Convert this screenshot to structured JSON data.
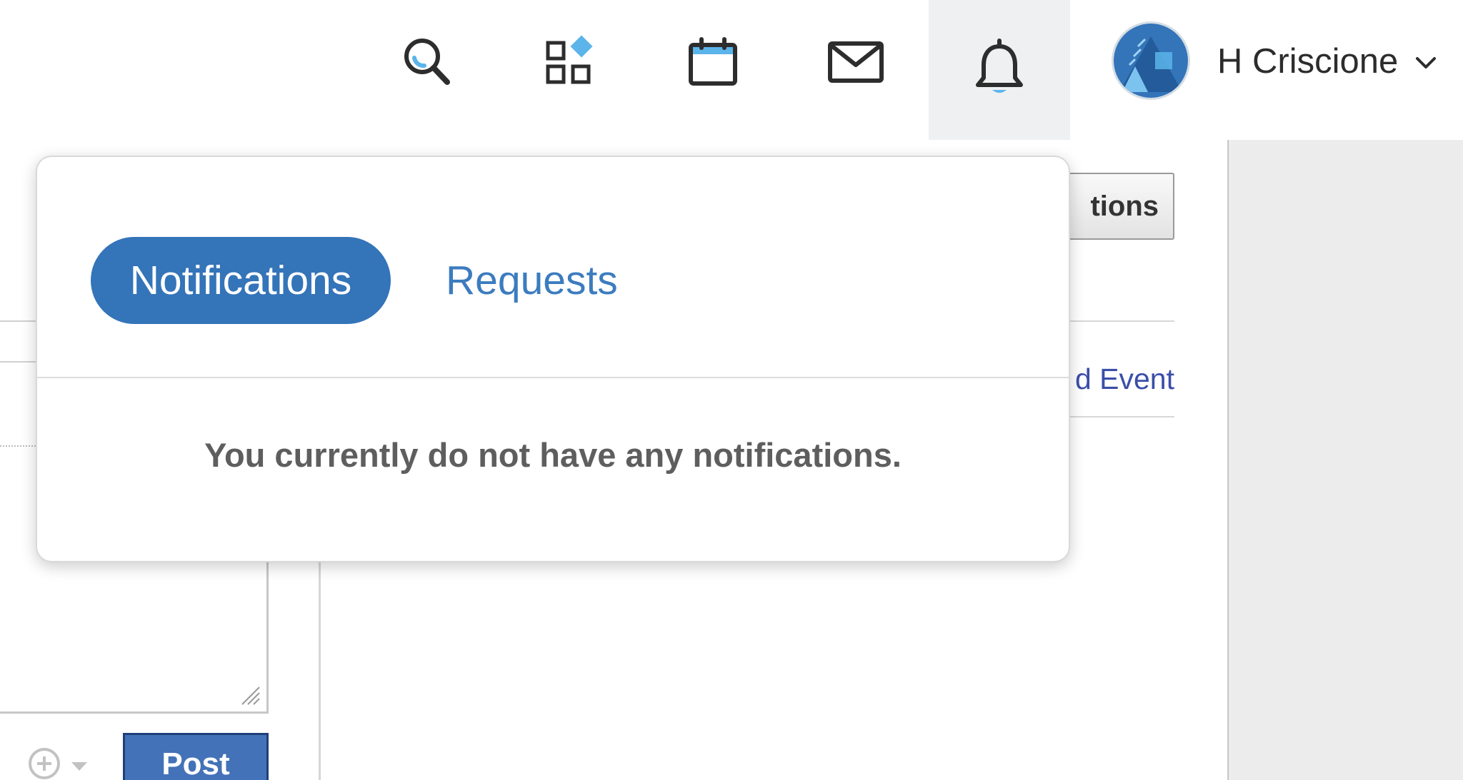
{
  "header": {
    "user_name": "H Criscione",
    "icons": [
      "search-icon",
      "apps-icon",
      "calendar-icon",
      "mail-icon",
      "bell-icon"
    ]
  },
  "popover": {
    "tabs": [
      {
        "label": "Notifications",
        "active": true
      },
      {
        "label": "Requests",
        "active": false
      }
    ],
    "empty_message": "You currently do not have any notifications."
  },
  "background": {
    "button_label": "tions",
    "link_label": "d Event",
    "post_label": "Post"
  },
  "colors": {
    "accent": "#3474b9",
    "accent_light": "#5bb4ea",
    "active_nav_bg": "#eef0f1",
    "post_button": "#4372b8"
  }
}
